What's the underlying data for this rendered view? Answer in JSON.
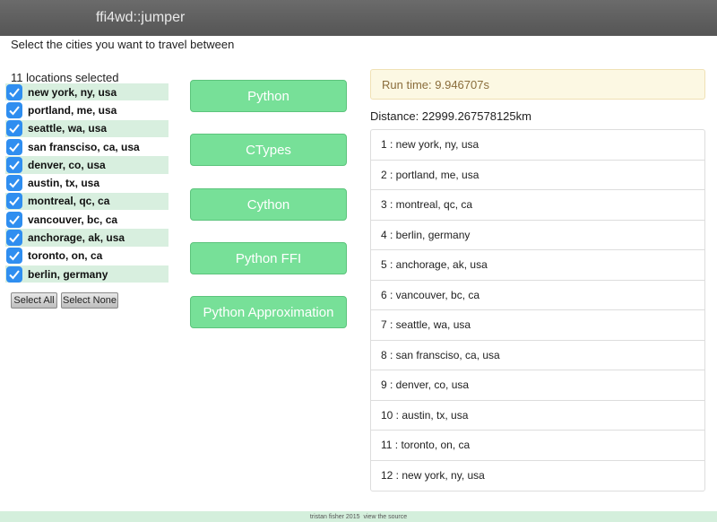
{
  "app": {
    "title": "ffi4wd::jumper"
  },
  "instructions": "Select the cities you want to travel between",
  "selection_count": "11 locations selected",
  "cities": [
    {
      "label": "new york, ny, usa",
      "checked": true
    },
    {
      "label": "portland, me, usa",
      "checked": true
    },
    {
      "label": "seattle, wa, usa",
      "checked": true
    },
    {
      "label": "san fransciso, ca, usa",
      "checked": true
    },
    {
      "label": "denver, co, usa",
      "checked": true
    },
    {
      "label": "austin, tx, usa",
      "checked": true
    },
    {
      "label": "montreal, qc, ca",
      "checked": true
    },
    {
      "label": "vancouver, bc, ca",
      "checked": true
    },
    {
      "label": "anchorage, ak, usa",
      "checked": true
    },
    {
      "label": "toronto, on, ca",
      "checked": true
    },
    {
      "label": "berlin, germany",
      "checked": true
    }
  ],
  "buttons": {
    "select_all": "Select All",
    "select_none": "Select None"
  },
  "algorithms": [
    {
      "label": "Python"
    },
    {
      "label": "CTypes"
    },
    {
      "label": "Cython"
    },
    {
      "label": "Python FFI"
    },
    {
      "label": "Python Approximation"
    }
  ],
  "result": {
    "runtime": "Run time: 9.946707s",
    "distance": "Distance: 22999.267578125km"
  },
  "route": [
    "1 : new york, ny, usa",
    "2 : portland, me, usa",
    "3 : montreal, qc, ca",
    "4 : berlin, germany",
    "5 : anchorage, ak, usa",
    "6 : vancouver, bc, ca",
    "7 : seattle, wa, usa",
    "8 : san fransciso, ca, usa",
    "9 : denver, co, usa",
    "10 : austin, tx, usa",
    "11 : toronto, on, ca",
    "12 : new york, ny, usa"
  ],
  "footer": {
    "credit": "tristan fisher 2015",
    "source_link": "view the source"
  },
  "colors": {
    "topbar": "#5f5f5f",
    "algo_button": "#77e098",
    "checkbox": "#2f8ef0",
    "row_shade": "#d8efdf",
    "runtime_bg": "#fcf8e3",
    "runtime_text": "#8a6d3b",
    "footer_bg": "#d4efdc"
  }
}
